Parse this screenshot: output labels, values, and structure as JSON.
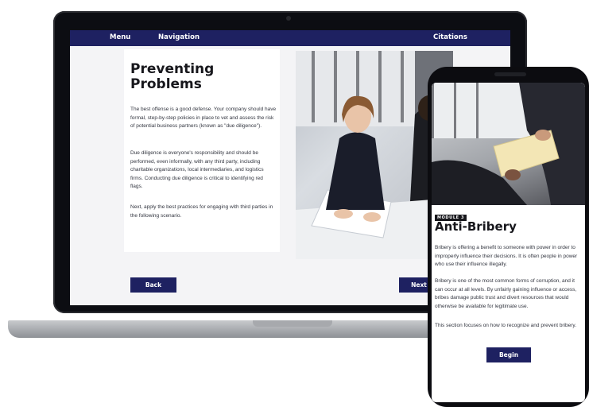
{
  "laptop": {
    "nav": {
      "menu": "Menu",
      "navigation": "Navigation",
      "citations": "Citations"
    },
    "title": "Preventing\nProblems",
    "paragraphs": [
      "The best offense is a good defense. Your company should have formal, step-by-step policies in place to vet and assess the risk of potential business partners (known as \"due diligence\").",
      "Due diligence is everyone's responsibility and should be performed, even informally, with any third party, including charitable organizations, local intermediaries, and logistics firms. Conducting due diligence is critical to identifying red flags.",
      "Next, apply the best practices for engaging with third parties in the following scenario."
    ],
    "back_label": "Back",
    "next_label": "Next"
  },
  "phone": {
    "badge": "MODULE 3",
    "title": "Anti-Bribery",
    "paragraphs": [
      "Bribery is offering a benefit to someone with power in order to improperly influence their decisions. It is often people in power who use their influence illegally.",
      "Bribery is one of the most common forms of corruption, and it can occur at all levels. By unfairly gaining influence or access, bribes damage public trust and divert resources that would otherwise be available for legitimate use.",
      "This section focuses on how to recognize and prevent bribery."
    ],
    "begin_label": "Begin"
  },
  "colors": {
    "nav_bg": "#1e2161",
    "button_bg": "#1e2161",
    "device_frame": "#0c0d12"
  }
}
